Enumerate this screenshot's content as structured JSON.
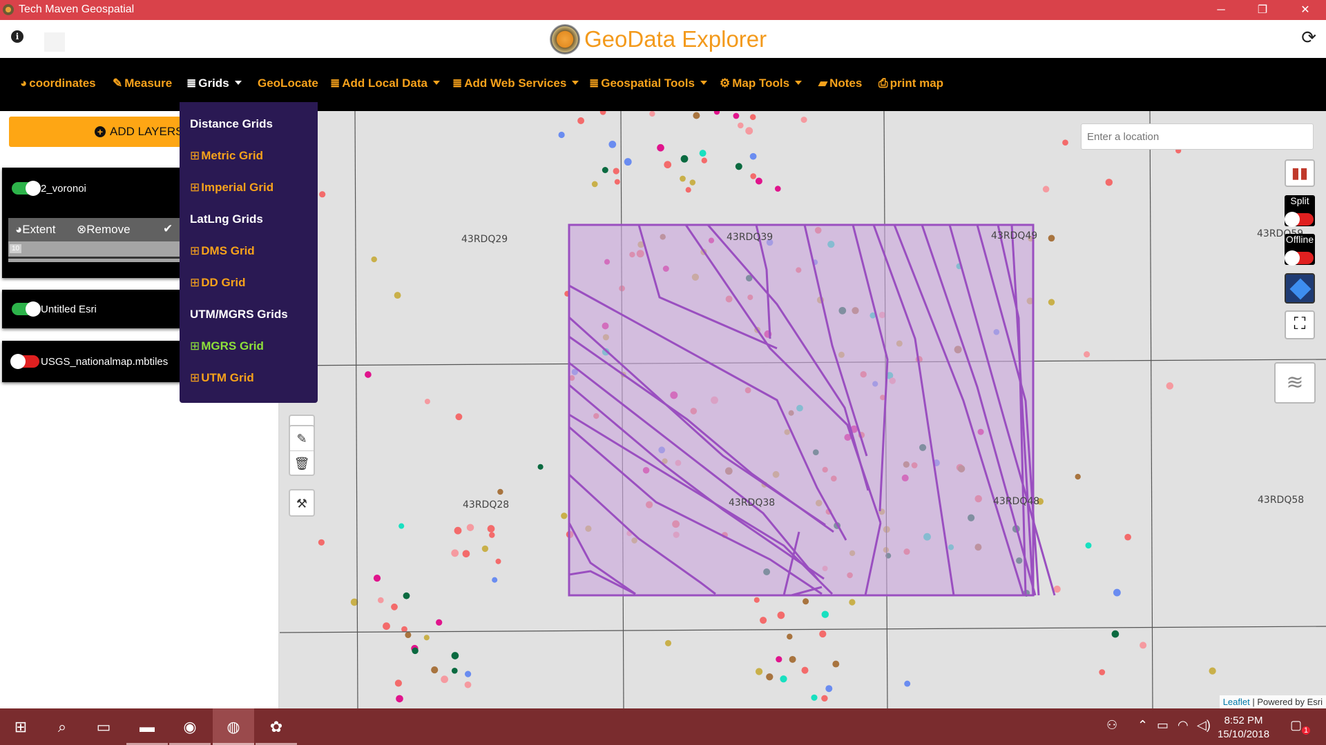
{
  "window": {
    "title": "Tech Maven Geospatial",
    "minimize": "─",
    "restore": "❐",
    "close": "✕"
  },
  "header": {
    "info_icon": "i",
    "brand": "GeoData Explorer",
    "refresh_icon": "⟳"
  },
  "navbar": {
    "items": [
      {
        "label": "coordinates",
        "icon": "globe-icon",
        "glyph": "◕"
      },
      {
        "label": "Measure",
        "icon": "edit-icon",
        "glyph": "✎"
      },
      {
        "label": "Grids",
        "icon": "database-icon",
        "glyph": "≣"
      },
      {
        "label": "GeoLocate",
        "icon": "",
        "glyph": ""
      },
      {
        "label": "Add Local Data",
        "icon": "database-icon",
        "glyph": "≣"
      },
      {
        "label": "Add Web Services",
        "icon": "database-icon",
        "glyph": "≣"
      },
      {
        "label": "Geospatial Tools",
        "icon": "database-icon",
        "glyph": "≣"
      },
      {
        "label": "Map Tools",
        "icon": "cogs-icon",
        "glyph": "⚙"
      },
      {
        "label": "Notes",
        "icon": "sticky-note-icon",
        "glyph": "▰"
      },
      {
        "label": "print map",
        "icon": "print-icon",
        "glyph": "⎙"
      }
    ]
  },
  "grids_menu": {
    "items": [
      {
        "label": "Distance Grids",
        "type": "header"
      },
      {
        "label": "Metric Grid",
        "type": "item"
      },
      {
        "label": "Imperial Grid",
        "type": "item"
      },
      {
        "label": "LatLng Grids",
        "type": "header"
      },
      {
        "label": "DMS Grid",
        "type": "item"
      },
      {
        "label": "DD Grid",
        "type": "item"
      },
      {
        "label": "UTM/MGRS Grids",
        "type": "header"
      },
      {
        "label": "MGRS Grid",
        "type": "active"
      },
      {
        "label": "UTM Grid",
        "type": "item"
      }
    ],
    "map_icon": "🗺"
  },
  "left_panel": {
    "add_layers_label": "ADD LAYERS",
    "layers": [
      {
        "name": "2_voronoi",
        "enabled": true
      },
      {
        "name": "Untitled Esri",
        "enabled": true
      },
      {
        "name": "USGS_nationalmap.mbtiles",
        "enabled": false
      }
    ],
    "layer_toolbar": {
      "extent_label": "Extent",
      "remove_label": "Remove",
      "check_icon": "✔"
    },
    "opacity_value": "10"
  },
  "map": {
    "search_placeholder": "Enter a location",
    "grid_labels": [
      "43RDQ29",
      "43RDQ39",
      "43RDQ49",
      "43RDQ59",
      "43RDQ28",
      "43RDQ38",
      "43RDQ48",
      "43RDQ58"
    ],
    "split_label": "Split",
    "offline_label": "Offline",
    "attribution_leaflet": "Leaflet",
    "attribution_rest": " | Powered by Esri",
    "colors": {
      "voronoi_stroke": "#9a4fc0",
      "voronoi_fill": "#c9a6dc",
      "grid_line": "#555555"
    }
  },
  "taskbar": {
    "time": "8:52 PM",
    "date": "15/10/2018",
    "notification_count": "1"
  }
}
